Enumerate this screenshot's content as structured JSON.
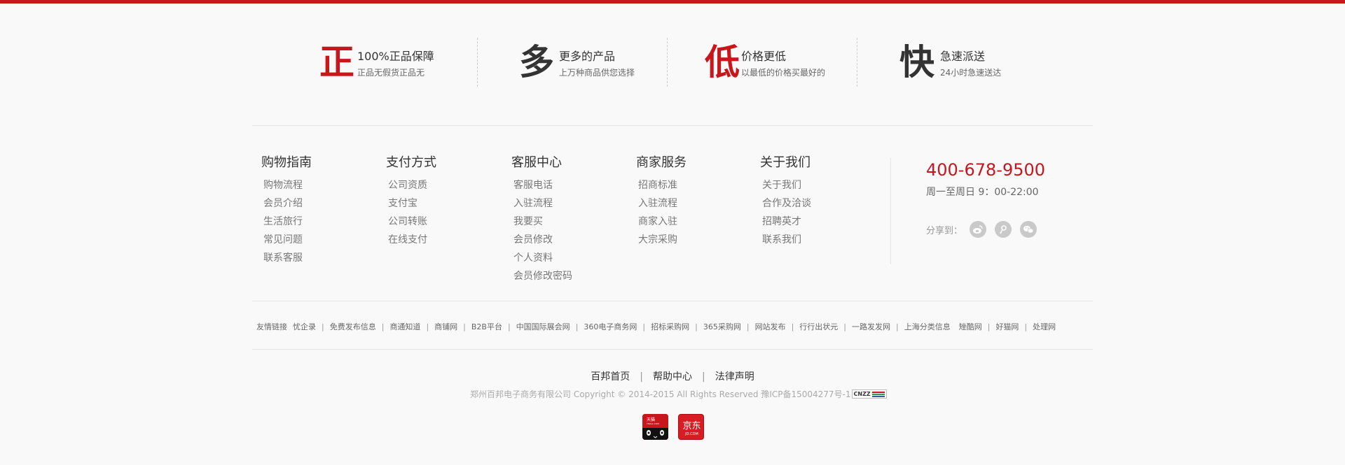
{
  "colors": {
    "accent": "#c8161d",
    "text_dark": "#333333",
    "text_mid": "#666666",
    "text_light": "#999999"
  },
  "guarantees": [
    {
      "char": "正",
      "title": "100%正品保障",
      "subtitle": "正品无假货正品无",
      "color": "#c8161d"
    },
    {
      "char": "多",
      "title": "更多的产品",
      "subtitle": "上万种商品供您选择",
      "color": "#333333"
    },
    {
      "char": "低",
      "title": "价格更低",
      "subtitle": "以最低的价格买最好的",
      "color": "#c8161d"
    },
    {
      "char": "快",
      "title": "急速派送",
      "subtitle": "24小时急速送达",
      "color": "#333333"
    }
  ],
  "columns": [
    {
      "title": "购物指南",
      "links": [
        "购物流程",
        "会员介绍",
        "生活旅行",
        "常见问题",
        "联系客服"
      ]
    },
    {
      "title": "支付方式",
      "links": [
        "公司资质",
        "支付宝",
        "公司转账",
        "在线支付"
      ]
    },
    {
      "title": "客服中心",
      "links": [
        "客服电话",
        "入驻流程",
        "我要买",
        "会员修改",
        "个人资料",
        "会员修改密码"
      ]
    },
    {
      "title": "商家服务",
      "links": [
        "招商标准",
        "入驻流程",
        "商家入驻",
        "大宗采购"
      ]
    },
    {
      "title": "关于我们",
      "links": [
        "关于我们",
        "合作及洽谈",
        "招聘英才",
        "联系我们"
      ]
    }
  ],
  "contact": {
    "phone": "400-678-9500",
    "hours": "周一至周日 9：00-22:00",
    "share_label": "分享到：",
    "share_icons": [
      "weibo-icon",
      "tencent-weibo-icon",
      "wechat-icon"
    ]
  },
  "friend_links": {
    "label": "友情链接",
    "first": "忧企录",
    "items": [
      "免费发布信息",
      "商通知道",
      "商铺网",
      "B2B平台",
      "中国国际展会网",
      "360电子商务网",
      "招标采购网",
      "365采购网",
      "网站发布",
      "行行出状元",
      "一路发发网",
      "上海分类信息"
    ],
    "items2": [
      "矬酷网",
      "好猫网",
      "处理网"
    ]
  },
  "bottom_nav": [
    "百邦首页",
    "帮助中心",
    "法律声明"
  ],
  "copyright": "郑州百邦电子商务有限公司 Copyright © 2014-2015 All Rights Reserved 豫ICP备15004277号-1",
  "cnzz_label": "CNZZ",
  "badges": {
    "tmall": "天猫",
    "tmall_sub": "TMALL.COM",
    "jd": "京东",
    "jd_sub": "JD.COM"
  }
}
